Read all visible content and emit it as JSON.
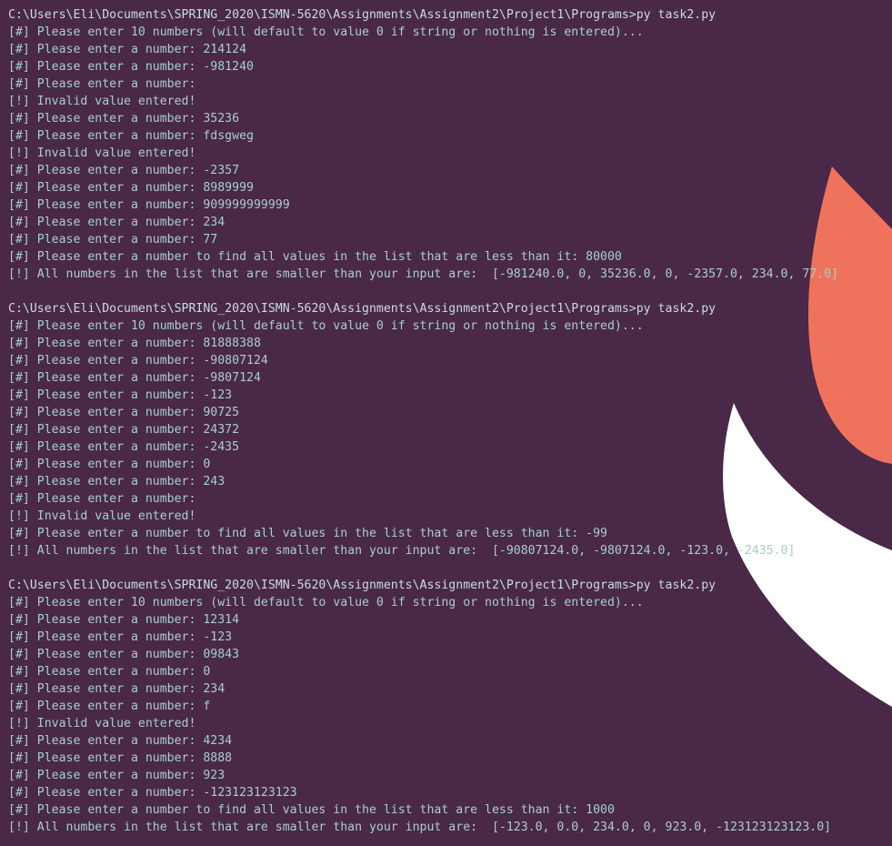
{
  "colors": {
    "background": "#4a2848",
    "text": "#a7cfcb",
    "accent_shape_orange": "#ef735c",
    "accent_shape_white": "#ffffff"
  },
  "terminal": {
    "lines": [
      "C:\\Users\\Eli\\Documents\\SPRING_2020\\ISMN-5620\\Assignments\\Assignment2\\Project1\\Programs>py task2.py",
      "[#] Please enter 10 numbers (will default to value 0 if string or nothing is entered)...",
      "[#] Please enter a number: 214124",
      "[#] Please enter a number: -981240",
      "[#] Please enter a number:",
      "[!] Invalid value entered!",
      "[#] Please enter a number: 35236",
      "[#] Please enter a number: fdsgweg",
      "[!] Invalid value entered!",
      "[#] Please enter a number: -2357",
      "[#] Please enter a number: 8989999",
      "[#] Please enter a number: 909999999999",
      "[#] Please enter a number: 234",
      "[#] Please enter a number: 77",
      "[#] Please enter a number to find all values in the list that are less than it: 80000",
      "[!] All numbers in the list that are smaller than your input are:  [-981240.0, 0, 35236.0, 0, -2357.0, 234.0, 77.0]",
      "",
      "C:\\Users\\Eli\\Documents\\SPRING_2020\\ISMN-5620\\Assignments\\Assignment2\\Project1\\Programs>py task2.py",
      "[#] Please enter 10 numbers (will default to value 0 if string or nothing is entered)...",
      "[#] Please enter a number: 81888388",
      "[#] Please enter a number: -90807124",
      "[#] Please enter a number: -9807124",
      "[#] Please enter a number: -123",
      "[#] Please enter a number: 90725",
      "[#] Please enter a number: 24372",
      "[#] Please enter a number: -2435",
      "[#] Please enter a number: 0",
      "[#] Please enter a number: 243",
      "[#] Please enter a number:",
      "[!] Invalid value entered!",
      "[#] Please enter a number to find all values in the list that are less than it: -99",
      "[!] All numbers in the list that are smaller than your input are:  [-90807124.0, -9807124.0, -123.0, -2435.0]",
      "",
      "C:\\Users\\Eli\\Documents\\SPRING_2020\\ISMN-5620\\Assignments\\Assignment2\\Project1\\Programs>py task2.py",
      "[#] Please enter 10 numbers (will default to value 0 if string or nothing is entered)...",
      "[#] Please enter a number: 12314",
      "[#] Please enter a number: -123",
      "[#] Please enter a number: 09843",
      "[#] Please enter a number: 0",
      "[#] Please enter a number: 234",
      "[#] Please enter a number: f",
      "[!] Invalid value entered!",
      "[#] Please enter a number: 4234",
      "[#] Please enter a number: 8888",
      "[#] Please enter a number: 923",
      "[#] Please enter a number: -123123123123",
      "[#] Please enter a number to find all values in the list that are less than it: 1000",
      "[!] All numbers in the list that are smaller than your input are:  [-123.0, 0.0, 234.0, 0, 923.0, -123123123123.0]"
    ]
  }
}
